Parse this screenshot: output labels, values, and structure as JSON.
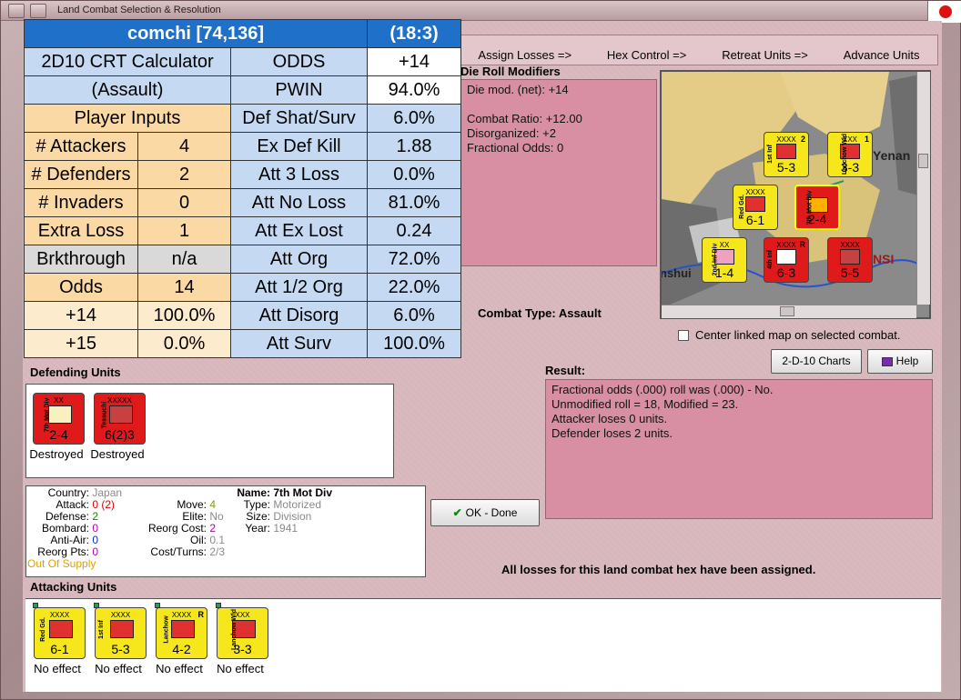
{
  "window": {
    "title": "Land Combat Selection & Resolution"
  },
  "phases": [
    "Assign Losses =>",
    "Hex Control =>",
    "Retreat Units =>",
    "Advance Units"
  ],
  "crt": {
    "header_left": "comchi [74,136]",
    "header_right": "(18:3)",
    "title1": "2D10 CRT Calculator",
    "title2": "(Assault)",
    "player_inputs": "Player Inputs",
    "inputs": [
      {
        "label": "# Attackers",
        "value": "4"
      },
      {
        "label": "# Defenders",
        "value": "2"
      },
      {
        "label": "# Invaders",
        "value": "0"
      },
      {
        "label": "Extra Loss",
        "value": "1"
      },
      {
        "label": "Brkthrough",
        "value": "n/a"
      },
      {
        "label": "Odds",
        "value": "14"
      },
      {
        "label": "+14",
        "value": "100.0%"
      },
      {
        "label": "+15",
        "value": "0.0%"
      }
    ],
    "results": [
      {
        "label": "ODDS",
        "value": "+14"
      },
      {
        "label": "PWIN",
        "value": "94.0%"
      },
      {
        "label": "Def Shat/Surv",
        "value": "6.0%"
      },
      {
        "label": "Ex Def Kill",
        "value": "1.88"
      },
      {
        "label": "Att 3 Loss",
        "value": "0.0%"
      },
      {
        "label": "Att No Loss",
        "value": "81.0%"
      },
      {
        "label": "Att Ex Lost",
        "value": "0.24"
      },
      {
        "label": "Att Org",
        "value": "72.0%"
      },
      {
        "label": "Att 1/2 Org",
        "value": "22.0%"
      },
      {
        "label": "Att Disorg",
        "value": "6.0%"
      },
      {
        "label": "Att Surv",
        "value": "100.0%"
      }
    ]
  },
  "modifiers": {
    "title": "Die Roll Modifiers",
    "lines": [
      "Die mod. (net): +14",
      "",
      "Combat Ratio: +12.00",
      "Disorganized: +2",
      "Fractional Odds: 0"
    ]
  },
  "combat_type": {
    "label": "Combat Type:",
    "value": "Assault"
  },
  "map": {
    "center_checkbox": "Center linked map on selected combat.",
    "place_yenan": "Yenan",
    "place_nsi": "NSI",
    "place_nshui": "nshui",
    "counters": [
      {
        "label": "1st Inf",
        "size": "XXXX",
        "value": "5-3",
        "tag": "2"
      },
      {
        "label": "Lanchow Wld",
        "size": "XXX",
        "value": "3-3",
        "tag": "1"
      },
      {
        "label": "Red Gd.",
        "size": "XXXX",
        "value": "6-1",
        "tag": ""
      },
      {
        "label": "7th Mot Div",
        "size": "",
        "value": "2-4",
        "tag": "2"
      },
      {
        "label": "2nd Inf Div",
        "size": "XX",
        "value": "1-4",
        "tag": "2"
      },
      {
        "label": "4th Inf",
        "size": "XXXX",
        "value": "6-3",
        "tag": "R"
      },
      {
        "label": "",
        "size": "XXXX",
        "value": "5-5",
        "tag": ""
      }
    ]
  },
  "buttons": {
    "charts": "2-D-10 Charts",
    "help": "Help",
    "ok": "OK - Done"
  },
  "result": {
    "title": "Result:",
    "lines": [
      "Fractional odds (.000) roll was (.000)  - No.",
      "Unmodified roll = 18, Modified = 23.",
      "Attacker loses 0 units.",
      "Defender loses 2 units."
    ]
  },
  "defending": {
    "title": "Defending Units",
    "units": [
      {
        "label": "7th Mot Div",
        "size": "XX",
        "value": "2-4",
        "status": "Destroyed"
      },
      {
        "label": "Tessuchi",
        "size": "XXXXX",
        "value": "6(2)3",
        "status": "Destroyed"
      }
    ]
  },
  "unit_info": {
    "country_k": "Country:",
    "country_v": "Japan",
    "attack_k": "Attack:",
    "attack_v": "0",
    "attack_v2": "(2)",
    "defense_k": "Defense:",
    "defense_v": "2",
    "bombard_k": "Bombard:",
    "bombard_v": "0",
    "antiair_k": "Anti-Air:",
    "antiair_v": "0",
    "reorg_k": "Reorg Pts:",
    "reorg_v": "0",
    "supply": "Out Of Supply",
    "move_k": "Move:",
    "move_v": "4",
    "elite_k": "Elite:",
    "elite_v": "No",
    "reorgcost_k": "Reorg Cost:",
    "reorgcost_v": "2",
    "oil_k": "Oil:",
    "oil_v": "0.1",
    "cost_k": "Cost/Turns:",
    "cost_v": "2/3",
    "name_k": "Name:",
    "name_v": "7th Mot Div",
    "type_k": "Type:",
    "type_v": "Motorized",
    "size_k": "Size:",
    "size_v": "Division",
    "year_k": "Year:",
    "year_v": "1941"
  },
  "status_msg": "All losses for this land combat hex have been assigned.",
  "attacking": {
    "title": "Attacking Units",
    "units": [
      {
        "label": "Red Gd.",
        "size": "XXXX",
        "value": "6-1",
        "tag": "",
        "status": "No effect"
      },
      {
        "label": "1st Inf",
        "size": "XXXX",
        "value": "5-3",
        "tag": "",
        "status": "No effect"
      },
      {
        "label": "Lanchow",
        "size": "XXXX",
        "value": "4-2",
        "tag": "R",
        "status": "No effect"
      },
      {
        "label": "Lanchow Wld",
        "size": "XXX",
        "value": "3-3",
        "tag": "",
        "status": "No effect"
      }
    ]
  },
  "colors": {
    "pink_panel": "#d88fa4",
    "crt_header": "#1f70c8",
    "attacker_yellow": "#f5e71b",
    "defender_red": "#e01a1a"
  }
}
